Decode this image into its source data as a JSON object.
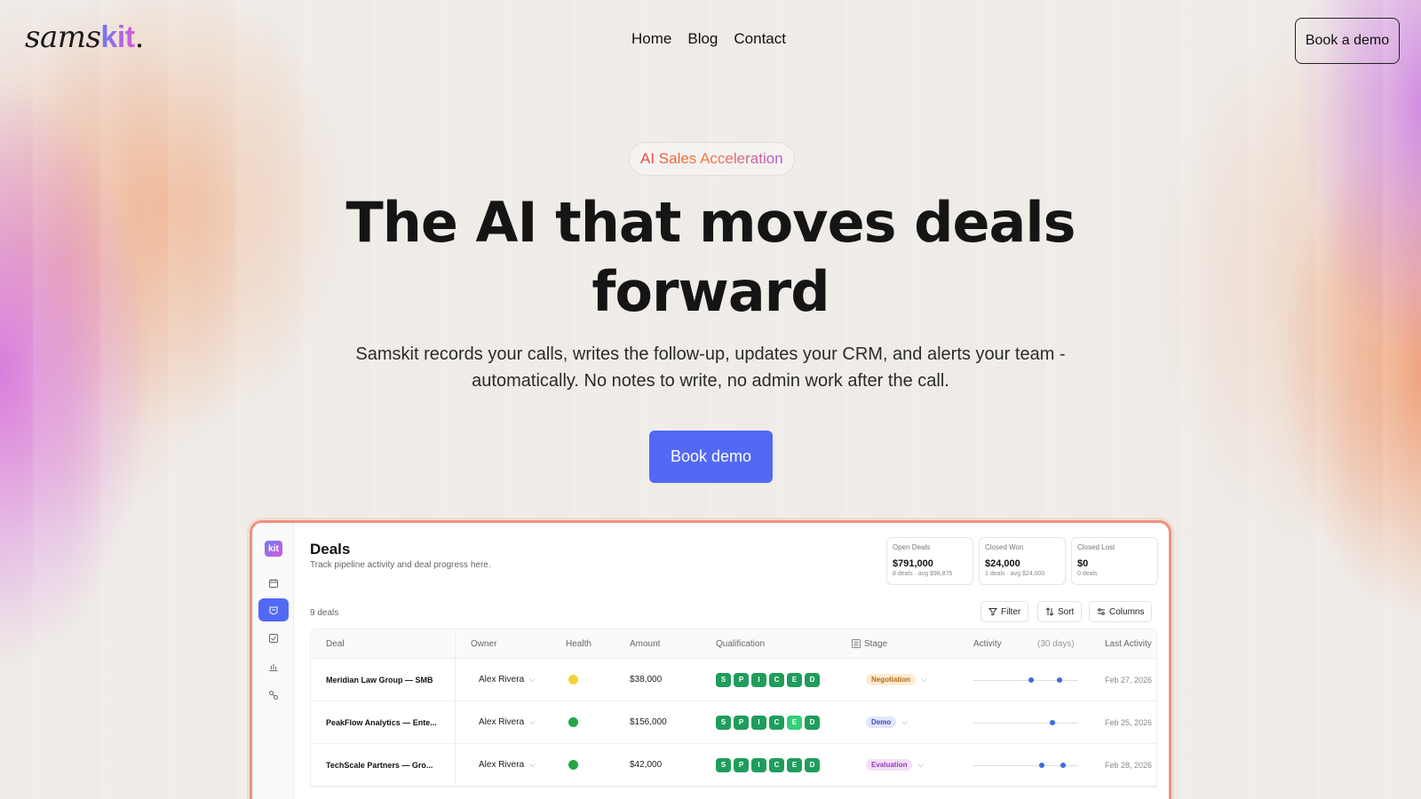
{
  "brand": {
    "logo_main": "sams",
    "logo_accent": "kit",
    "logo_dot": "."
  },
  "nav": {
    "items": [
      "Home",
      "Blog",
      "Contact"
    ],
    "cta": "Book a demo"
  },
  "hero": {
    "badge": "AI Sales Acceleration",
    "title": "The AI that moves deals forward",
    "subtitle": "Samskit records your calls, writes the follow-up, updates your CRM, and alerts your team - automatically. No notes to write, no admin work after the call.",
    "cta": "Book demo"
  },
  "app": {
    "logo": "kit",
    "sidebar_icons": [
      "calendar-icon",
      "deals-icon",
      "tasks-icon",
      "chart-icon",
      "integrations-icon"
    ],
    "title": "Deals",
    "subtitle": "Track pipeline activity and deal progress here.",
    "stats": [
      {
        "label": "Open Deals",
        "value": "$791,000",
        "meta": "8 deals · avg $98,875"
      },
      {
        "label": "Closed Won",
        "value": "$24,000",
        "meta": "1 deals · avg $24,000"
      },
      {
        "label": "Closed Lost",
        "value": "$0",
        "meta": "0 deals"
      }
    ],
    "count": "9 deals",
    "toolbar": {
      "filter": "Filter",
      "sort": "Sort",
      "columns": "Columns"
    },
    "columns": {
      "deal": "Deal",
      "owner": "Owner",
      "health": "Health",
      "amount": "Amount",
      "qualification": "Qualification",
      "stage": "Stage",
      "activity": "Activity",
      "activity_range": "(30 days)",
      "last_activity": "Last Activity"
    },
    "qualification_letters": [
      "S",
      "P",
      "I",
      "C",
      "E",
      "D"
    ],
    "rows": [
      {
        "deal": "Meridian Law Group — SMB",
        "owner": "Alex Rivera",
        "health_color": "#f2d23a",
        "amount": "$38,000",
        "stage": "Negotiation",
        "stage_bg": "#fdebd5",
        "stage_fg": "#b86a10",
        "last": "Feb 27, 2026",
        "light_index": -1,
        "activity": [
          0.55,
          0.82
        ]
      },
      {
        "deal": "PeakFlow Analytics — Ente...",
        "owner": "Alex Rivera",
        "health_color": "#22a845",
        "amount": "$156,000",
        "stage": "Demo",
        "stage_bg": "#e2e6fb",
        "stage_fg": "#3c4bb8",
        "last": "Feb 25, 2026",
        "light_index": 4,
        "activity": [
          0.75
        ]
      },
      {
        "deal": "TechScale Partners — Gro...",
        "owner": "Alex Rivera",
        "health_color": "#22a845",
        "amount": "$42,000",
        "stage": "Evaluation",
        "stage_bg": "#f3e1f8",
        "stage_fg": "#9a3ab8",
        "last": "Feb 28, 2026",
        "light_index": -1,
        "activity": [
          0.65,
          0.86
        ]
      }
    ]
  }
}
